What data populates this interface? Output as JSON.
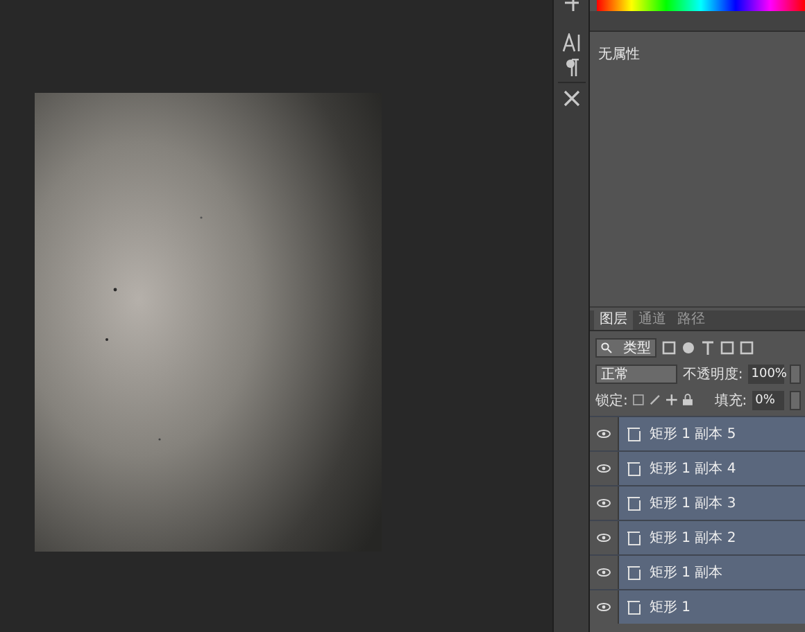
{
  "properties": {
    "text": "无属性"
  },
  "layers_panel": {
    "tabs": [
      {
        "label": "图层",
        "selected": true
      },
      {
        "label": "通道",
        "selected": false
      },
      {
        "label": "路径",
        "selected": false
      }
    ],
    "filter": {
      "value": "类型"
    },
    "blend_mode": {
      "value": "正常"
    },
    "opacity": {
      "label": "不透明度:",
      "value": "100%"
    },
    "lock": {
      "label": "锁定:"
    },
    "fill": {
      "label": "填充:",
      "value": "0%"
    },
    "layers": [
      {
        "name": "矩形 1 副本 5",
        "visible": true,
        "selected": true
      },
      {
        "name": "矩形 1 副本 4",
        "visible": true,
        "selected": true
      },
      {
        "name": "矩形 1 副本 3",
        "visible": true,
        "selected": true
      },
      {
        "name": "矩形 1 副本 2",
        "visible": true,
        "selected": true
      },
      {
        "name": "矩形 1 副本",
        "visible": true,
        "selected": true
      },
      {
        "name": "矩形 1",
        "visible": true,
        "selected": true
      }
    ]
  }
}
